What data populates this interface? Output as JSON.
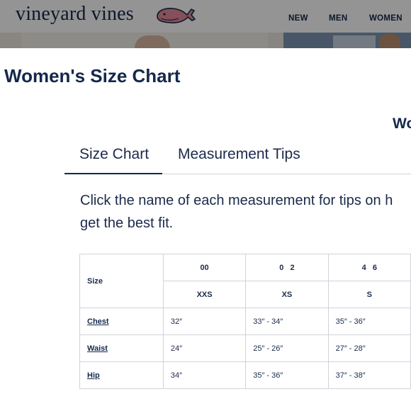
{
  "header": {
    "logo_text": "vineyard vines",
    "nav": [
      "NEW",
      "MEN",
      "WOMEN"
    ],
    "whale_color": "#e58a9b"
  },
  "modal": {
    "title": "Women's Size Chart",
    "subtitle_partial": "Wo",
    "tabs": [
      {
        "label": "Size Chart",
        "active": true
      },
      {
        "label": "Measurement Tips",
        "active": false
      }
    ],
    "intro_line1": "Click the name of each measurement for tips on h",
    "intro_line2": "get the best fit."
  },
  "size_table": {
    "size_label": "Size",
    "numeric_sizes": [
      "00",
      "0   2",
      "4   6"
    ],
    "letter_sizes": [
      "XXS",
      "XS",
      "S"
    ],
    "rows": [
      {
        "name": "Chest",
        "values": [
          "32″",
          "33″ - 34″",
          "35″ - 36″"
        ]
      },
      {
        "name": "Waist",
        "values": [
          "24″",
          "25″ - 26″",
          "27″ - 28″"
        ]
      },
      {
        "name": "Hip",
        "values": [
          "34″",
          "35″ - 36″",
          "37″ - 38″"
        ]
      }
    ]
  },
  "colors": {
    "navy": "#14284b",
    "border": "#cfd3da"
  }
}
